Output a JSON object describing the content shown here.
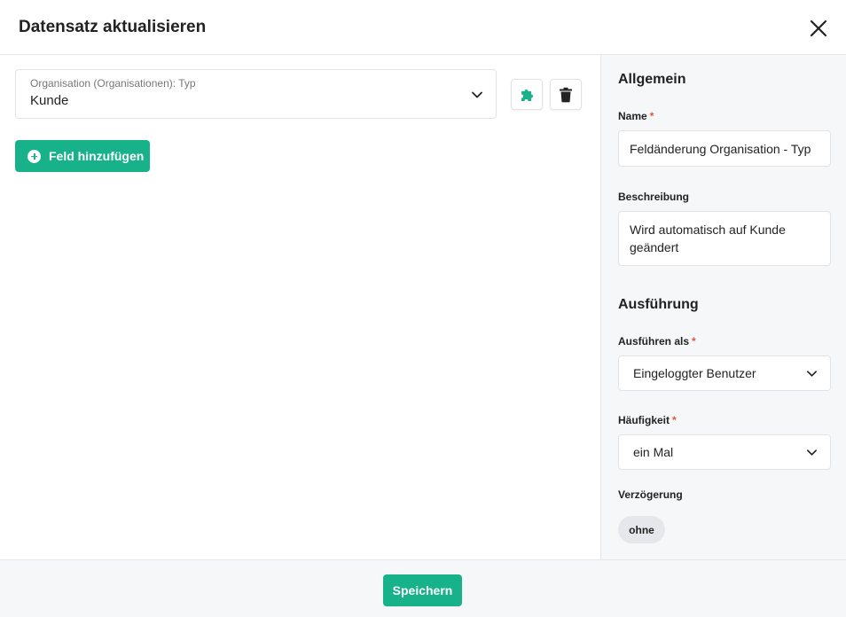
{
  "dialog": {
    "title": "Datensatz aktualisieren"
  },
  "field": {
    "label": "Organisation (Organisationen): Typ",
    "value": "Kunde"
  },
  "main": {
    "add_field_label": "Feld hinzufügen"
  },
  "sidebar": {
    "general_title": "Allgemein",
    "name_label": "Name",
    "name_value": "Feldänderung Organisation - Typ",
    "description_label": "Beschreibung",
    "description_value": "Wird automatisch auf Kunde geändert",
    "execution_title": "Ausführung",
    "run_as_label": "Ausführen als",
    "run_as_value": "Eingeloggter Benutzer",
    "frequency_label": "Häufigkeit",
    "frequency_value": "ein Mal",
    "delay_label": "Verzögerung",
    "delay_value": "ohne",
    "required_mark": "*"
  },
  "footer": {
    "save_label": "Speichern"
  },
  "colors": {
    "accent": "#17b28a",
    "required": "#e5533d",
    "panel_bg": "#f6f7f9"
  },
  "icons": [
    "close-icon",
    "chevron-down-icon",
    "puzzle-icon",
    "trash-icon",
    "plus-circle-icon"
  ]
}
